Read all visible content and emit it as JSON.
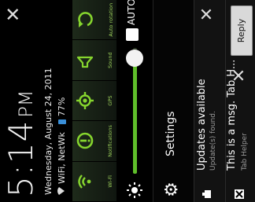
{
  "status": {
    "time": "5:14",
    "ampm": "PM",
    "date": "Wednesday, August 24, 2011",
    "network": "WiFi, NetWk",
    "battery": "77%"
  },
  "toggles": [
    {
      "label": "Wi-Fi",
      "icon": "wifi-icon"
    },
    {
      "label": "Notifications",
      "icon": "notifications-icon"
    },
    {
      "label": "GPS",
      "icon": "gps-icon"
    },
    {
      "label": "Sound",
      "icon": "sound-icon"
    },
    {
      "label": "Auto rotation",
      "icon": "rotation-icon"
    }
  ],
  "brightness": {
    "auto_label": "AUTO",
    "level": 0.92
  },
  "settings": {
    "label": "Settings"
  },
  "notifications": [
    {
      "title": "Updates available",
      "subtitle": "Update(s) found.",
      "icon": "update-icon"
    },
    {
      "title": "This is a msg. Tab H...",
      "subtitle": "Tab Helper",
      "icon": "tab-helper-icon",
      "action": "Reply"
    }
  ],
  "colors": {
    "accent": "#86d52e",
    "background": "#000000"
  }
}
